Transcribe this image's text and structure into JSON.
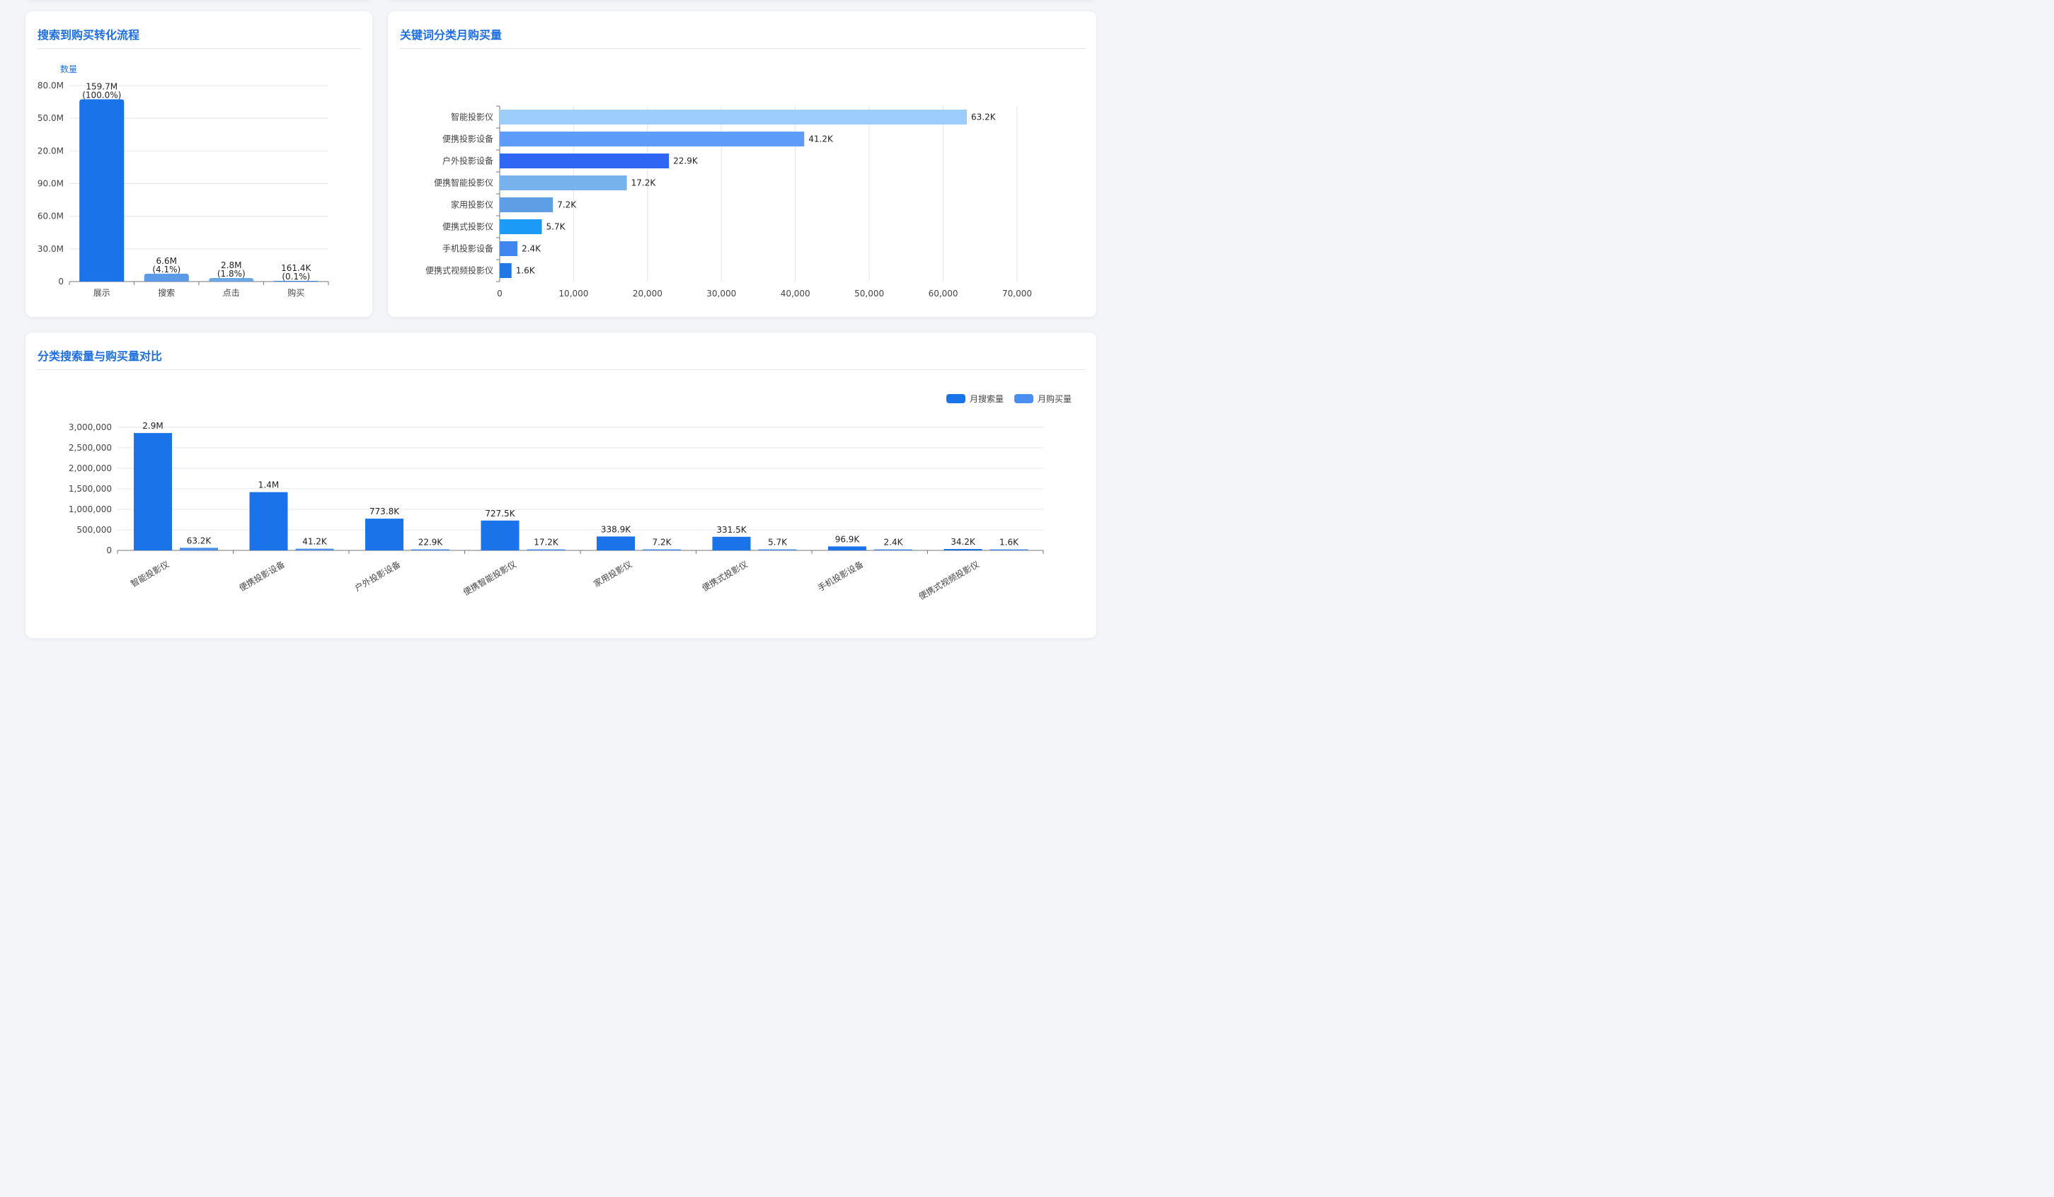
{
  "panels": {
    "funnel": {
      "title": "搜索到购买转化流程"
    },
    "keywords": {
      "title": "关键词分类月购买量"
    },
    "compare": {
      "title": "分类搜索量与购买量对比"
    }
  },
  "colors": {
    "accent": "#1f6fe0",
    "bar_primary": "#1a73e8",
    "bar_secondary": "#4a8ef0"
  },
  "chart_data": [
    {
      "type": "bar",
      "title": "搜索到购买转化流程",
      "ylabel": "数量",
      "categories": [
        "展示",
        "搜索",
        "点击",
        "购买"
      ],
      "values": [
        159700000,
        6600000,
        2800000,
        161400
      ],
      "data_labels": [
        "159.7M",
        "6.6M",
        "2.8M",
        "161.4K"
      ],
      "percent_labels": [
        "(100.0%)",
        "(4.1%)",
        "(1.8%)",
        "(0.1%)"
      ],
      "bar_fill_fraction": [
        0.93,
        0.04,
        0.018,
        0.002
      ],
      "y_tick_labels": [
        "0",
        "30.0M",
        "60.0M",
        "90.0M",
        "20.0M",
        "50.0M",
        "80.0M"
      ],
      "colors": [
        "#1a73e8",
        "#5b9ae6",
        "#6aa7e6",
        "#3a86ea"
      ],
      "grid": true
    },
    {
      "type": "bar",
      "orientation": "horizontal",
      "title": "关键词分类月购买量",
      "categories": [
        "智能投影仪",
        "便携投影设备",
        "户外投影设备",
        "便携智能投影仪",
        "家用投影仪",
        "便携式投影仪",
        "手机投影设备",
        "便携式视频投影仪"
      ],
      "values": [
        63200,
        41200,
        22900,
        17200,
        7200,
        5700,
        2400,
        1600
      ],
      "data_labels": [
        "63.2K",
        "41.2K",
        "22.9K",
        "17.2K",
        "7.2K",
        "5.7K",
        "2.4K",
        "1.6K"
      ],
      "colors": [
        "#9ccdfb",
        "#5d9cf8",
        "#2f66f4",
        "#78b2ec",
        "#5f9de5",
        "#1b9af7",
        "#3f87ef",
        "#2078e6"
      ],
      "xlim": [
        0,
        70000
      ],
      "x_ticks": [
        0,
        10000,
        20000,
        30000,
        40000,
        50000,
        60000,
        70000
      ],
      "x_tick_labels": [
        "0",
        "10,000",
        "20,000",
        "30,000",
        "40,000",
        "50,000",
        "60,000",
        "70,000"
      ],
      "grid": true
    },
    {
      "type": "bar",
      "title": "分类搜索量与购买量对比",
      "categories": [
        "智能投影仪",
        "便携投影设备",
        "户外投影设备",
        "便携智能投影仪",
        "家用投影仪",
        "便携式投影仪",
        "手机投影设备",
        "便携式视频投影仪"
      ],
      "series": [
        {
          "name": "月搜索量",
          "values": [
            2860000,
            1420000,
            773800,
            727500,
            338900,
            331500,
            96900,
            34200
          ],
          "labels": [
            "2.9M",
            "1.4M",
            "773.8K",
            "727.5K",
            "338.9K",
            "331.5K",
            "96.9K",
            "34.2K"
          ],
          "color": "#1a73e8"
        },
        {
          "name": "月购买量",
          "values": [
            63200,
            41200,
            22900,
            17200,
            7200,
            5700,
            2400,
            1600
          ],
          "labels": [
            "63.2K",
            "41.2K",
            "22.9K",
            "17.2K",
            "7.2K",
            "5.7K",
            "2.4K",
            "1.6K"
          ],
          "color": "#4a8ef0"
        }
      ],
      "ylim": [
        0,
        3000000
      ],
      "y_ticks": [
        0,
        500000,
        1000000,
        1500000,
        2000000,
        2500000,
        3000000
      ],
      "y_tick_labels": [
        "0",
        "500,000",
        "1,000,000",
        "1,500,000",
        "2,000,000",
        "2,500,000",
        "3,000,000"
      ],
      "legend": "top-right",
      "grid": true
    }
  ]
}
